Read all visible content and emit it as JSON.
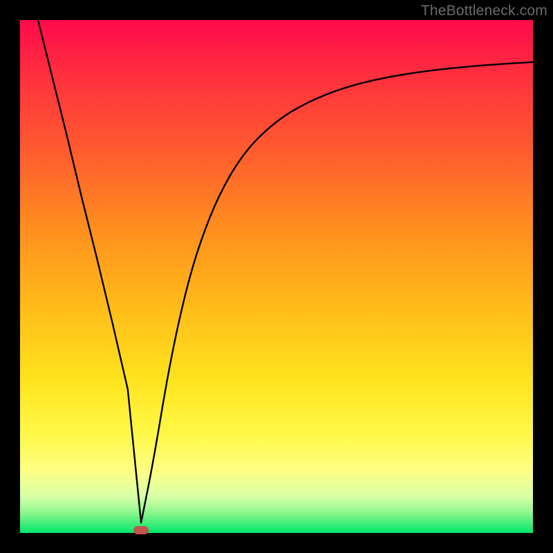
{
  "watermark": "TheBottleneck.com",
  "chart_data": {
    "type": "line",
    "title": "",
    "xlabel": "",
    "ylabel": "",
    "xlim": [
      0,
      1
    ],
    "ylim": [
      0,
      1
    ],
    "series": [
      {
        "name": "curve",
        "x": [
          0.035,
          0.06,
          0.09,
          0.12,
          0.15,
          0.18,
          0.21,
          0.236,
          0.26,
          0.29,
          0.32,
          0.35,
          0.39,
          0.44,
          0.5,
          0.56,
          0.63,
          0.71,
          0.8,
          0.9,
          1.0
        ],
        "y": [
          1.0,
          0.9,
          0.78,
          0.655,
          0.535,
          0.41,
          0.28,
          0.02,
          0.14,
          0.32,
          0.46,
          0.565,
          0.665,
          0.747,
          0.804,
          0.84,
          0.868,
          0.888,
          0.902,
          0.912,
          0.918
        ]
      }
    ],
    "marker": {
      "x": 0.236,
      "y": 0.006
    },
    "gradient_stops": [
      {
        "pos": 0.0,
        "color": "#ff0a4a"
      },
      {
        "pos": 0.25,
        "color": "#ff5a2f"
      },
      {
        "pos": 0.55,
        "color": "#ffb91a"
      },
      {
        "pos": 0.81,
        "color": "#fff94a"
      },
      {
        "pos": 0.96,
        "color": "#8df78e"
      },
      {
        "pos": 1.0,
        "color": "#00e66a"
      }
    ]
  }
}
